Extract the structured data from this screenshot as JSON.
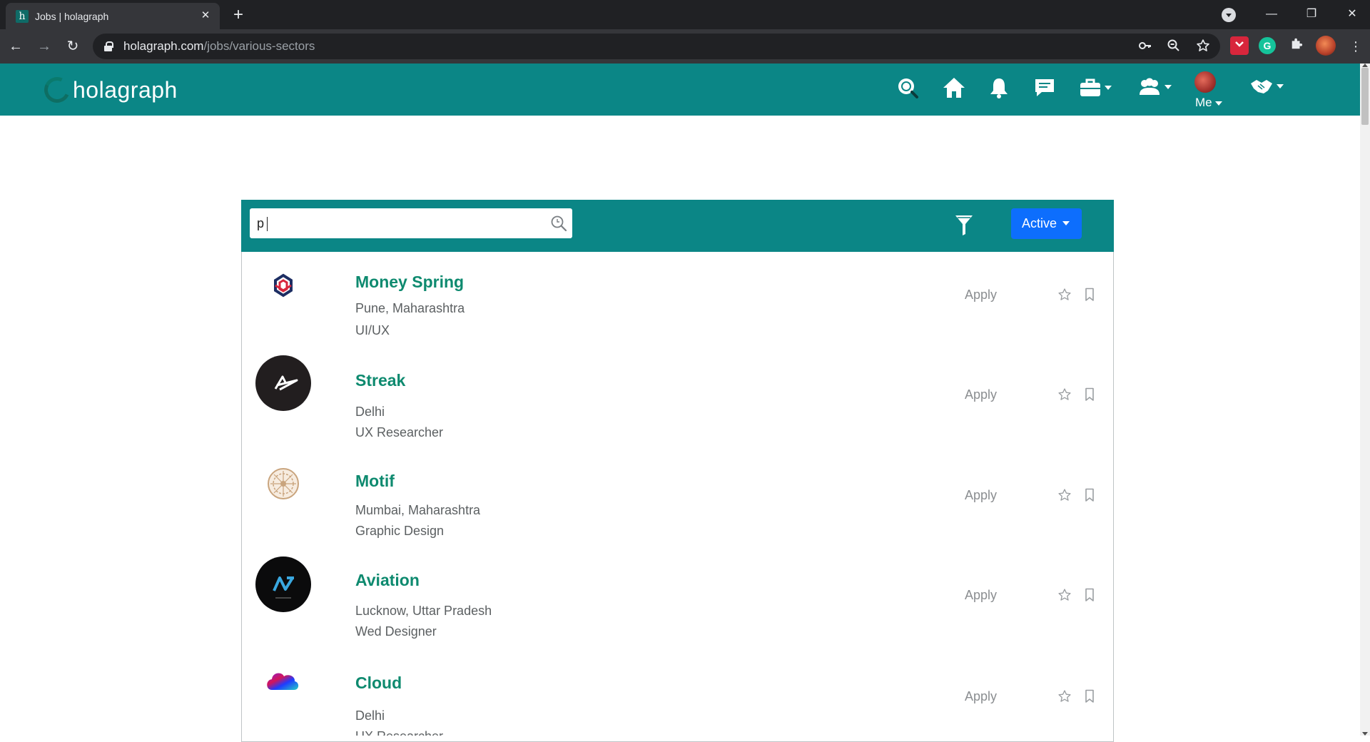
{
  "browser": {
    "tab_title": "Jobs | holagraph",
    "tab_favicon_letter": "h",
    "url_host": "holagraph.com",
    "url_path": "/jobs/various-sectors"
  },
  "site": {
    "logo_text": "holagraph",
    "me_label": "Me"
  },
  "jobs_panel": {
    "search_value": "p",
    "status_filter": "Active"
  },
  "jobs": [
    {
      "company": "Money Spring",
      "location": "Pune, Maharashtra",
      "role": "UI/UX",
      "apply_label": "Apply"
    },
    {
      "company": "Streak",
      "location": "Delhi",
      "role": "UX Researcher",
      "apply_label": "Apply"
    },
    {
      "company": "Motif",
      "location": "Mumbai, Maharashtra",
      "role": "Graphic Design",
      "apply_label": "Apply"
    },
    {
      "company": "Aviation",
      "location": "Lucknow, Uttar Pradesh",
      "role": "Wed Designer",
      "apply_label": "Apply"
    },
    {
      "company": "Cloud",
      "location": "Delhi",
      "role": "UX Researcher",
      "apply_label": "Apply"
    }
  ],
  "colors": {
    "brand_teal": "#0b8686",
    "title_green": "#0e8a6f",
    "primary_blue": "#0d6efd"
  }
}
